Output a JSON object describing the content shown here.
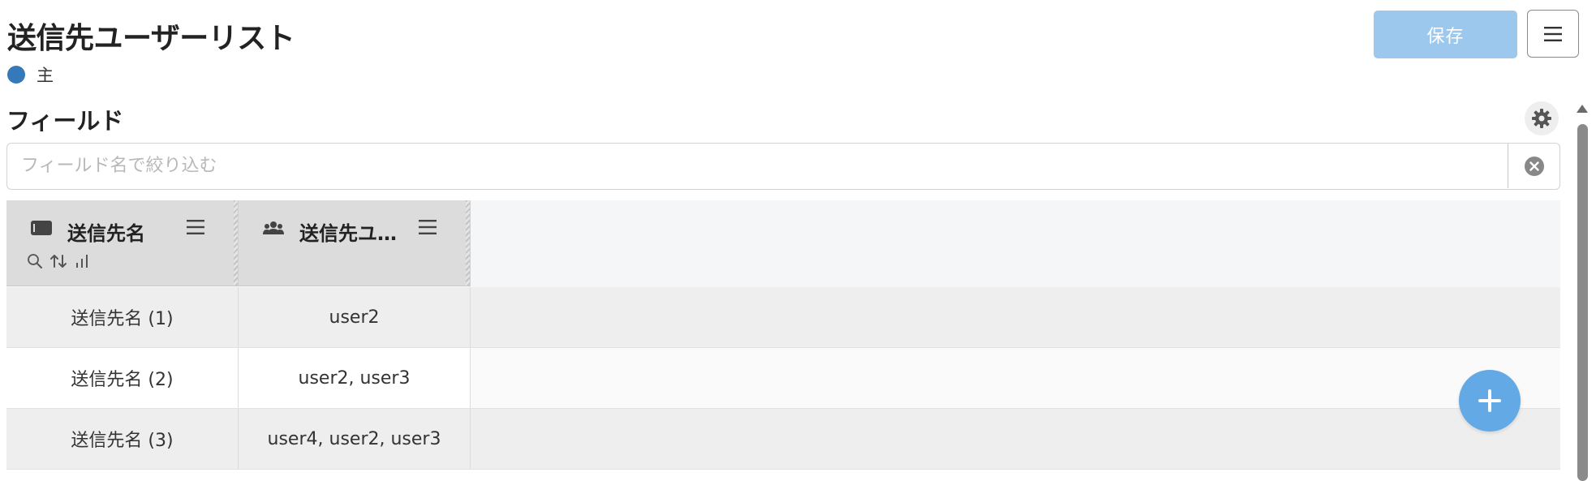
{
  "header": {
    "title": "送信先ユーザーリスト",
    "legend_label": "主",
    "legend_color": "#3579ba",
    "save_label": "保存",
    "menu_icon": "hamburger-icon"
  },
  "fields": {
    "section_title": "フィールド",
    "settings_icon": "gear-icon",
    "filter_placeholder": "フィールド名で絞り込む",
    "filter_value": "",
    "clear_icon": "clear-icon"
  },
  "table": {
    "columns": [
      {
        "label": "送信先名",
        "icon": "text-field-icon"
      },
      {
        "label": "送信先ユーザー",
        "icon": "users-icon"
      }
    ],
    "rows": [
      [
        "送信先名 (1)",
        "user2"
      ],
      [
        "送信先名 (2)",
        "user2, user3"
      ],
      [
        "送信先名 (3)",
        "user4, user2, user3"
      ]
    ]
  },
  "colors": {
    "accent": "#62a9e6",
    "save_button": "#9dc8ee",
    "header_cell": "#dcdcdc"
  },
  "fab_icon": "plus-icon"
}
